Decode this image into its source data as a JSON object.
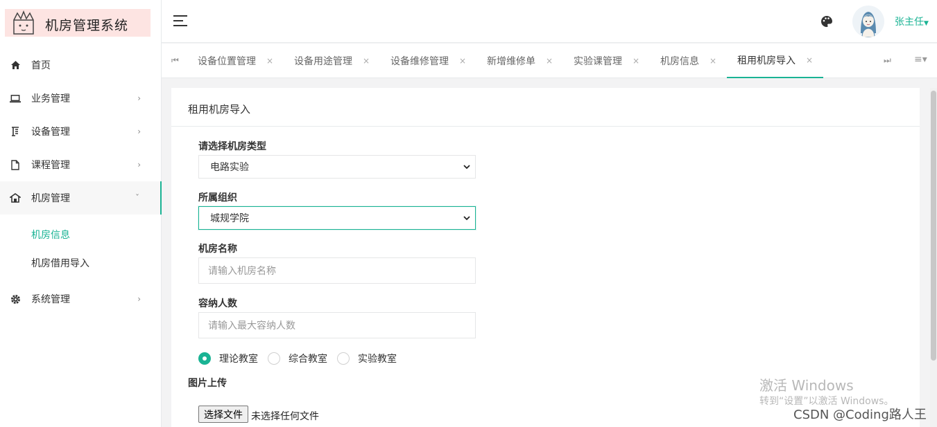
{
  "app": {
    "title": "机房管理系统"
  },
  "sidebar": {
    "items": [
      {
        "label": "首页",
        "icon": "home-icon"
      },
      {
        "label": "业务管理",
        "icon": "laptop-icon"
      },
      {
        "label": "设备管理",
        "icon": "equipment-icon"
      },
      {
        "label": "课程管理",
        "icon": "file-icon"
      },
      {
        "label": "机房管理",
        "icon": "building-icon"
      },
      {
        "label": "系统管理",
        "icon": "gear-icon"
      }
    ],
    "subitems": [
      {
        "label": "机房信息",
        "active": true
      },
      {
        "label": "机房借用导入",
        "active": false
      }
    ]
  },
  "header": {
    "username": "张主任"
  },
  "tabs": [
    {
      "label": "设备位置管理"
    },
    {
      "label": "设备用途管理"
    },
    {
      "label": "设备维修管理"
    },
    {
      "label": "新增维修单"
    },
    {
      "label": "实验课管理"
    },
    {
      "label": "机房信息"
    },
    {
      "label": "租用机房导入",
      "active": true
    }
  ],
  "tab_close": "×",
  "form": {
    "panel_title": "租用机房导入",
    "room_type_label": "请选择机房类型",
    "room_type_value": "电路实验",
    "org_label": "所属组织",
    "org_value": "城规学院",
    "room_name_label": "机房名称",
    "room_name_placeholder": "请输入机房名称",
    "capacity_label": "容纳人数",
    "capacity_placeholder": "请输入最大容纳人数",
    "radios": [
      {
        "label": "理论教室",
        "checked": true
      },
      {
        "label": "综合教室",
        "checked": false
      },
      {
        "label": "实验教室",
        "checked": false
      }
    ],
    "upload_label": "图片上传",
    "file_button": "选择文件",
    "file_status": "未选择任何文件"
  },
  "watermark": {
    "line1": "激活 Windows",
    "line2": "转到“设置”以激活 Windows。",
    "csdn": "CSDN @Coding路人王"
  },
  "colors": {
    "accent": "#1ab394",
    "logo_bg": "#fde4e2"
  }
}
